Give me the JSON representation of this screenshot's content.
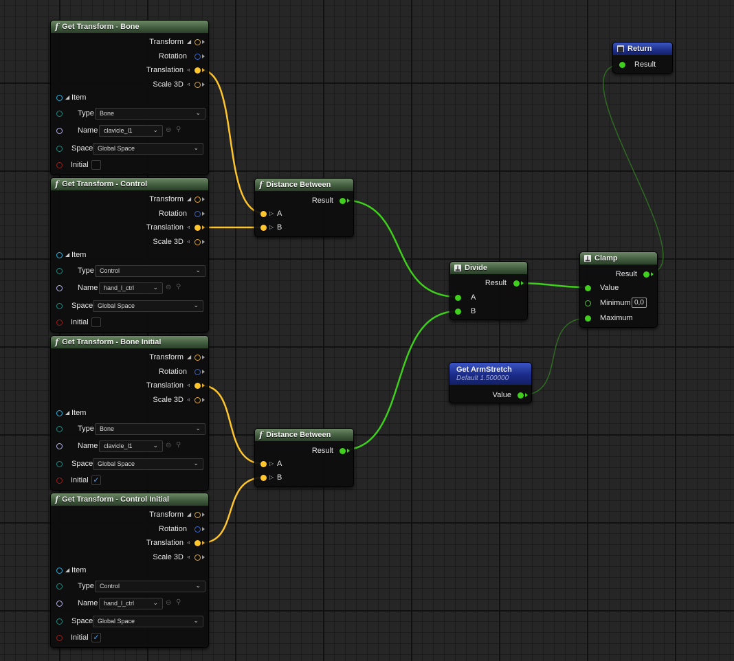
{
  "colors": {
    "exec_green": "#3fcf1c",
    "vector_yellow": "#ffc52d",
    "rotator_blue": "#3a66d8",
    "header_green": "#4a6544",
    "header_blue": "#1e2f8a"
  },
  "transform_nodes": [
    {
      "title": "Get Transform - Bone",
      "outputs": [
        "Transform",
        "Rotation",
        "Translation",
        "Scale 3D"
      ],
      "item_label": "Item",
      "type_label": "Type",
      "type_value": "Bone",
      "name_label": "Name",
      "name_value": "clavicle_l1",
      "space_label": "Space",
      "space_value": "Global Space",
      "initial_label": "Initial",
      "initial_checked": false
    },
    {
      "title": "Get Transform - Control",
      "outputs": [
        "Transform",
        "Rotation",
        "Translation",
        "Scale 3D"
      ],
      "item_label": "Item",
      "type_label": "Type",
      "type_value": "Control",
      "name_label": "Name",
      "name_value": "hand_l_ctrl",
      "space_label": "Space",
      "space_value": "Global Space",
      "initial_label": "Initial",
      "initial_checked": false
    },
    {
      "title": "Get Transform - Bone Initial",
      "outputs": [
        "Transform",
        "Rotation",
        "Translation",
        "Scale 3D"
      ],
      "item_label": "Item",
      "type_label": "Type",
      "type_value": "Bone",
      "name_label": "Name",
      "name_value": "clavicle_l1",
      "space_label": "Space",
      "space_value": "Global Space",
      "initial_label": "Initial",
      "initial_checked": true
    },
    {
      "title": "Get Transform - Control Initial",
      "outputs": [
        "Transform",
        "Rotation",
        "Translation",
        "Scale 3D"
      ],
      "item_label": "Item",
      "type_label": "Type",
      "type_value": "Control",
      "name_label": "Name",
      "name_value": "hand_l_ctrl",
      "space_label": "Space",
      "space_value": "Global Space",
      "initial_label": "Initial",
      "initial_checked": true
    }
  ],
  "distance_nodes": [
    {
      "title": "Distance Between",
      "output": "Result",
      "input_a": "A",
      "input_b": "B"
    },
    {
      "title": "Distance Between",
      "output": "Result",
      "input_a": "A",
      "input_b": "B"
    }
  ],
  "divide": {
    "title": "Divide",
    "output": "Result",
    "input_a": "A",
    "input_b": "B"
  },
  "clamp": {
    "title": "Clamp",
    "output": "Result",
    "value_label": "Value",
    "minimum_label": "Minimum",
    "minimum_value": "0,0",
    "maximum_label": "Maximum"
  },
  "return_node": {
    "title": "Return",
    "input": "Result"
  },
  "variable": {
    "title": "Get ArmStretch",
    "subtitle": "Default 1.500000",
    "output": "Value"
  },
  "icons": {
    "function": "function-icon",
    "math": "math-node-icon",
    "return": "return-icon"
  },
  "glyphs": {
    "function": "f",
    "math": "⊥",
    "return": "▤",
    "check": "✓",
    "chevron": "⌄",
    "reset": "⊖",
    "search": "⚲",
    "item_triangle": "◢",
    "translation_arrow": "◃",
    "input_arrow": "▷"
  }
}
